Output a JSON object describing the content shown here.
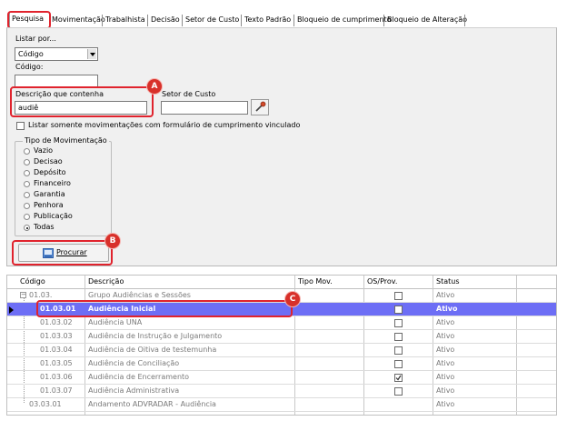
{
  "tabs": [
    {
      "label": "Pesquisa"
    },
    {
      "label": "Movimentação"
    },
    {
      "label": "Trabalhista"
    },
    {
      "label": "Decisão"
    },
    {
      "label": "Setor de Custo"
    },
    {
      "label": "Texto Padrão"
    },
    {
      "label": "Bloqueio de cumprimento"
    },
    {
      "label": "Bloqueio de Alteração"
    }
  ],
  "form": {
    "listar_label": "Listar por...",
    "listar_value": "Código",
    "codigo_label": "Código:",
    "codigo_value": "",
    "descricao_label": "Descrição que contenha",
    "descricao_value": "audiê",
    "setor_label": "Setor de Custo",
    "setor_value": "",
    "somente_label": "Listar somente movimentações com formulário de cumprimento vinculado",
    "tipo_group_label": "Tipo de Movimentação",
    "tipos": [
      "Vazio",
      "Decisao",
      "Depósito",
      "Financeiro",
      "Garantia",
      "Penhora",
      "Publicação",
      "Todas"
    ],
    "tipo_selected": "Todas",
    "procurar_label": "Procurar"
  },
  "markers": {
    "a": "A",
    "b": "B",
    "c": "C"
  },
  "grid": {
    "columns": [
      "Código",
      "Descrição",
      "Tipo Mov.",
      "OS/Prov.",
      "Status"
    ],
    "rows": [
      {
        "code": "01.03.",
        "desc": "Grupo Audiências e Sessões",
        "tipo": "",
        "os": false,
        "status": "Ativo"
      },
      {
        "code": "01.03.01",
        "desc": "Audiência Inicial",
        "tipo": "",
        "os": false,
        "status": "Ativo"
      },
      {
        "code": "01.03.02",
        "desc": "Audiência UNA",
        "tipo": "",
        "os": false,
        "status": "Ativo"
      },
      {
        "code": "01.03.03",
        "desc": "Audiência de Instrução e Julgamento",
        "tipo": "",
        "os": false,
        "status": "Ativo"
      },
      {
        "code": "01.03.04",
        "desc": "Audiência de Oitiva de testemunha",
        "tipo": "",
        "os": false,
        "status": "Ativo"
      },
      {
        "code": "01.03.05",
        "desc": "Audiência de Conciliação",
        "tipo": "",
        "os": false,
        "status": "Ativo"
      },
      {
        "code": "01.03.06",
        "desc": "Audiência de Encerramento",
        "tipo": "",
        "os": true,
        "status": "Ativo"
      },
      {
        "code": "01.03.07",
        "desc": "Audiência Administrativa",
        "tipo": "",
        "os": false,
        "status": "Ativo"
      },
      {
        "code": "03.03.01",
        "desc": "Andamento ADVRADAR - Audiência",
        "tipo": "",
        "os": false,
        "status": "Ativo"
      }
    ]
  },
  "colors": {
    "selected_row": "#6d6ef5",
    "highlight": "#e0232d",
    "marker": "#d8302a"
  }
}
